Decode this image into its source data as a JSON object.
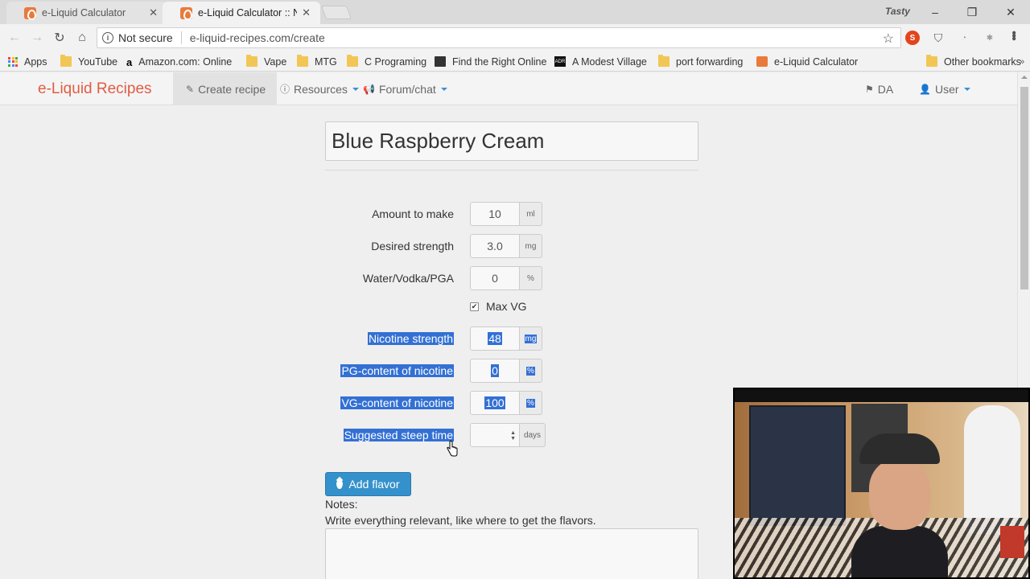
{
  "browser": {
    "tabs": [
      {
        "title": "e-Liquid Calculator",
        "active": false
      },
      {
        "title": "e-Liquid Calculator :: New",
        "active": true
      }
    ],
    "profile_name": "Tasty",
    "window_controls": {
      "minimize": "–",
      "restore": "❐",
      "close": "✕"
    },
    "nav": {
      "back": "←",
      "forward": "→",
      "reload": "↻",
      "home": "⌂"
    },
    "omnibox": {
      "security_label": "Not secure",
      "url": "e-liquid-recipes.com/create"
    },
    "bookmarks": [
      {
        "label": "Apps",
        "icon": "apps-grid-icon"
      },
      {
        "label": "YouTube",
        "icon": "folder-icon"
      },
      {
        "label": "Amazon.com: Online",
        "icon": "amazon-icon"
      },
      {
        "label": "Vape",
        "icon": "folder-icon"
      },
      {
        "label": "MTG",
        "icon": "folder-icon"
      },
      {
        "label": "C Programing",
        "icon": "folder-icon"
      },
      {
        "label": "Find the Right Online",
        "icon": "site-icon"
      },
      {
        "label": "A Modest Village",
        "icon": "adr-icon"
      },
      {
        "label": "port forwarding",
        "icon": "folder-icon"
      },
      {
        "label": "e-Liquid Calculator",
        "icon": "eliquid-icon"
      },
      {
        "label": "Other bookmarks",
        "icon": "folder-icon"
      }
    ],
    "bookmarks_more": "»"
  },
  "site": {
    "brand": "e-Liquid Recipes",
    "nav": {
      "create": "Create recipe",
      "resources": "Resources",
      "forum": "Forum/chat",
      "language": "DA",
      "user": "User"
    }
  },
  "form": {
    "recipe_name": "Blue Raspberry Cream",
    "rows": [
      {
        "label": "Amount to make",
        "value": "10",
        "unit": "ml",
        "selected": false
      },
      {
        "label": "Desired strength",
        "value": "3.0",
        "unit": "mg",
        "selected": false
      },
      {
        "label": "Water/Vodka/PGA",
        "value": "0",
        "unit": "%",
        "selected": false
      },
      {
        "label": "Nicotine strength",
        "value": "48",
        "unit": "mg",
        "selected": true
      },
      {
        "label": "PG-content of nicotine",
        "value": "0",
        "unit": "%",
        "selected": true
      },
      {
        "label": "VG-content of nicotine",
        "value": "100",
        "unit": "%",
        "selected": true
      },
      {
        "label": "Suggested steep time",
        "value": "",
        "unit": "days",
        "selected": true
      }
    ],
    "max_vg": {
      "label": "Max VG",
      "checked": true
    },
    "add_flavor": "Add flavor",
    "notes_label": "Notes:",
    "notes_hint": "Write everything relevant, like where to get the flavors.",
    "notes_value": ""
  },
  "colors": {
    "brand": "#e05d44",
    "selection": "#3370d4",
    "primary_button": "#3591cc"
  }
}
